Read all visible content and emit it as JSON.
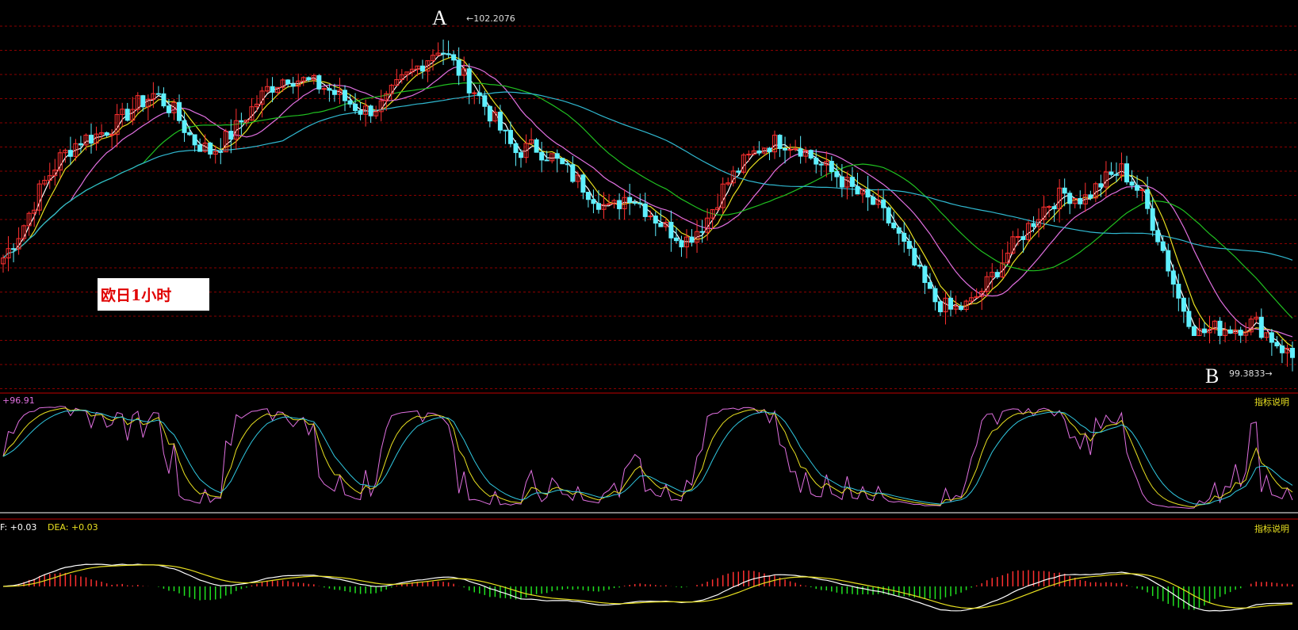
{
  "colors": {
    "background": "#000000",
    "grid": "#8a0000",
    "candle_up": "#ff3030",
    "candle_down": "#5ff0ff",
    "ma_fast": "#ffffff",
    "ma_yellow": "#e8e020",
    "ma_magenta": "#e070e0",
    "ma_green": "#20c020",
    "ma_cyan": "#30b8d0",
    "kdj_k": "#e070e0",
    "kdj_d": "#e8e020",
    "kdj_j": "#30c8e0",
    "macd_dif": "#ffffff",
    "macd_dea": "#e8e020",
    "hist_pos": "#ff3030",
    "hist_neg": "#20e020"
  },
  "labels": {
    "instrument_label": "欧日1小时",
    "marker_a": "A",
    "marker_b": "B",
    "high_tag": "←102.2076",
    "low_tag": "99.3833→",
    "kdj_value": "+96.91",
    "kdj_help": "指标说明",
    "macd_dif_label": "F: +0.03",
    "macd_dea_label": "DEA: +0.03",
    "macd_help": "指标说明"
  },
  "chart_data": [
    {
      "type": "candlestick",
      "price_high": 102.2076,
      "price_low": 99.3833,
      "close_path": [
        100.3,
        100.55,
        100.9,
        101.15,
        101.3,
        101.35,
        101.45,
        101.6,
        101.7,
        101.55,
        101.3,
        101.2,
        101.35,
        101.55,
        101.75,
        101.85,
        101.8,
        101.75,
        101.65,
        101.55,
        101.6,
        101.8,
        101.95,
        102.1,
        101.9,
        101.7,
        101.45,
        101.2,
        101.25,
        101.15,
        101.0,
        100.85,
        100.7,
        100.85,
        100.7,
        100.55,
        100.45,
        100.6,
        100.9,
        101.1,
        101.25,
        101.3,
        101.25,
        101.1,
        101.0,
        100.85,
        100.75,
        100.55,
        100.25,
        99.95,
        99.85,
        99.9,
        100.1,
        100.35,
        100.55,
        100.75,
        100.85,
        100.8,
        100.95,
        101.05,
        100.85,
        100.45,
        99.95,
        99.65,
        99.7,
        99.7,
        99.75,
        99.6,
        99.45
      ],
      "ma_series": [
        "MA fast",
        "MA yellow",
        "MA magenta",
        "MA green",
        "MA cyan"
      ]
    },
    {
      "type": "line",
      "indicator": "KDJ",
      "current_value": 96.91,
      "ylim": [
        0,
        100
      ]
    },
    {
      "type": "bar",
      "indicator": "MACD",
      "dif": 0.03,
      "dea": 0.03
    }
  ]
}
